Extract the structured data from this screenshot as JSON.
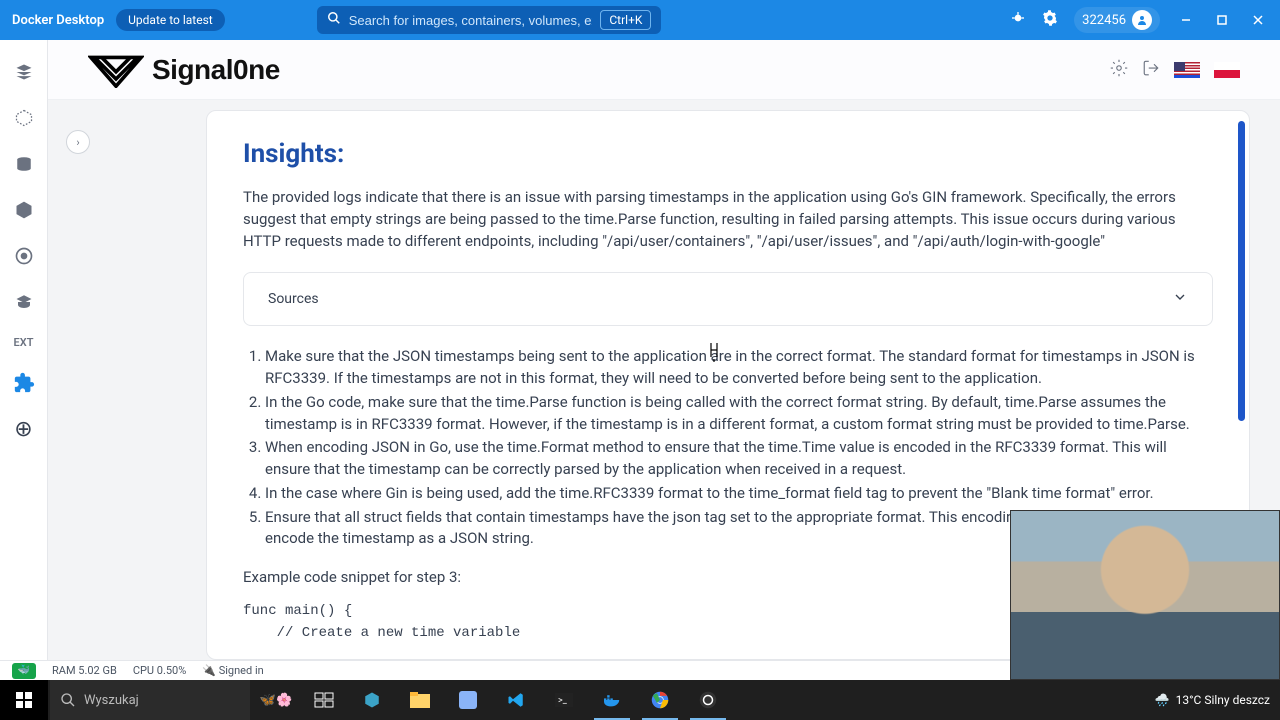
{
  "topBar": {
    "appName": "Docker Desktop",
    "updateLabel": "Update to latest",
    "searchPlaceholder": "Search for images, containers, volumes, extensions and more...",
    "shortcut": "Ctrl+K",
    "userId": "322456"
  },
  "extHeader": {
    "brand": "Signal0ne"
  },
  "sidebar": {
    "extLabel": "EXT"
  },
  "card": {
    "title": "Insights:",
    "summary": "The provided logs indicate that there is an issue with parsing timestamps in the application using Go's GIN framework. Specifically, the errors suggest that empty strings are being passed to the time.Parse function, resulting in failed parsing attempts. This issue occurs during various HTTP requests made to different endpoints, including \"/api/user/containers\", \"/api/user/issues\", and \"/api/auth/login-with-google\"",
    "accordionLabel": "Sources",
    "steps": [
      "Make sure that the JSON timestamps being sent to the application are in the correct format. The standard format for timestamps in JSON is RFC3339. If the timestamps are not in this format, they will need to be converted before being sent to the application.",
      "In the Go code, make sure that the time.Parse function is being called with the correct format string. By default, time.Parse assumes the timestamp is in RFC3339 format. However, if the timestamp is in a different format, a custom format string must be provided to time.Parse.",
      "When encoding JSON in Go, use the time.Format method to ensure that the time.Time value is encoded in the RFC3339 format. This will ensure that the timestamp can be correctly parsed by the application when received in a request.",
      "In the case where Gin is being used, add the time.RFC3339 format to the time_format field tag to prevent the \"Blank time format\" error.",
      "Ensure that all struct fields that contain timestamps have the json tag set to the appropriate format. This encoding/json package to properly encode the timestamp as a JSON string."
    ],
    "exampleLabel": "Example code snippet for step 3:",
    "codeLine1": "func main() {",
    "codeLine2": "    // Create a new time variable"
  },
  "statusBar": {
    "ram": "RAM 5.02 GB",
    "cpu": "CPU 0.50%",
    "signedIn": "Signed in"
  },
  "taskbar": {
    "searchPlaceholder": "Wyszukaj",
    "weather": "13°C  Silny deszcz"
  }
}
